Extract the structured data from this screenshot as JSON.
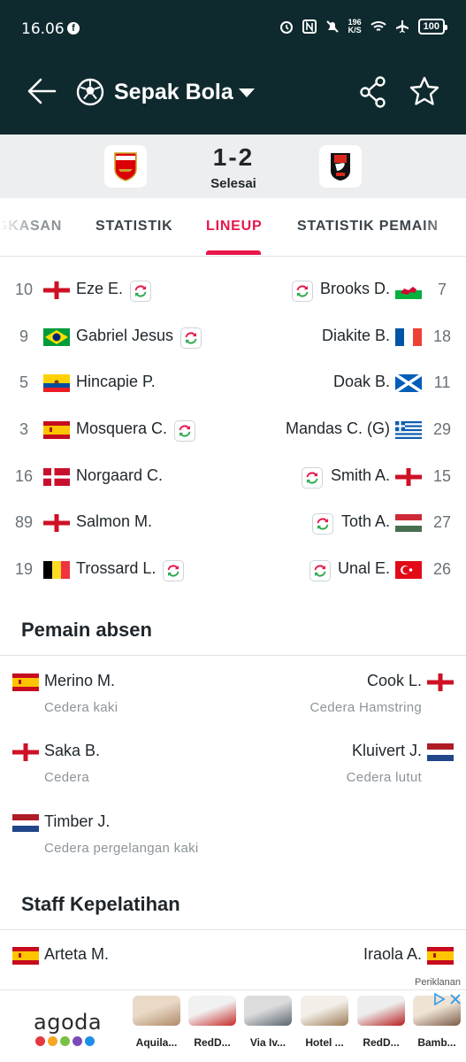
{
  "status_bar": {
    "time": "16.06",
    "net_speed_value": "196",
    "net_speed_unit": "K/S",
    "battery": "100"
  },
  "header": {
    "title": "Sepak Bola"
  },
  "match": {
    "score": "1-2",
    "status": "Selesai"
  },
  "tabs": [
    {
      "label": "GKASAN"
    },
    {
      "label": "STATISTIK"
    },
    {
      "label": "LINEUP"
    },
    {
      "label": "STATISTIK PEMAIN"
    }
  ],
  "lineup": {
    "home": [
      {
        "number": "10",
        "name": "Eze E.",
        "flag": "england",
        "sub": true
      },
      {
        "number": "9",
        "name": "Gabriel Jesus",
        "flag": "brazil",
        "sub": true
      },
      {
        "number": "5",
        "name": "Hincapie P.",
        "flag": "ecuador",
        "sub": false
      },
      {
        "number": "3",
        "name": "Mosquera C.",
        "flag": "spain",
        "sub": true
      },
      {
        "number": "16",
        "name": "Norgaard C.",
        "flag": "denmark",
        "sub": false
      },
      {
        "number": "89",
        "name": "Salmon M.",
        "flag": "england",
        "sub": false
      },
      {
        "number": "19",
        "name": "Trossard L.",
        "flag": "belgium",
        "sub": true
      }
    ],
    "away": [
      {
        "number": "7",
        "name": "Brooks D.",
        "flag": "wales",
        "sub": true
      },
      {
        "number": "18",
        "name": "Diakite B.",
        "flag": "france",
        "sub": false
      },
      {
        "number": "11",
        "name": "Doak B.",
        "flag": "scotland",
        "sub": false
      },
      {
        "number": "29",
        "name": "Mandas C. (G)",
        "flag": "greece",
        "sub": false
      },
      {
        "number": "15",
        "name": "Smith A.",
        "flag": "england",
        "sub": true
      },
      {
        "number": "27",
        "name": "Toth A.",
        "flag": "hungary",
        "sub": true
      },
      {
        "number": "26",
        "name": "Unal E.",
        "flag": "turkey",
        "sub": true
      }
    ]
  },
  "absent": {
    "title": "Pemain absen",
    "home": [
      {
        "name": "Merino M.",
        "reason": "Cedera kaki",
        "flag": "spain"
      },
      {
        "name": "Saka B.",
        "reason": "Cedera",
        "flag": "england"
      },
      {
        "name": "Timber J.",
        "reason": "Cedera pergelangan kaki",
        "flag": "netherlands"
      }
    ],
    "away": [
      {
        "name": "Cook L.",
        "reason": "Cedera Hamstring",
        "flag": "england"
      },
      {
        "name": "Kluivert J.",
        "reason": "Cedera lutut",
        "flag": "netherlands"
      }
    ]
  },
  "staff": {
    "title": "Staff Kepelatihan",
    "home": {
      "name": "Arteta M.",
      "flag": "spain"
    },
    "away": {
      "name": "Iraola A.",
      "flag": "spain"
    }
  },
  "ad": {
    "label": "Periklanan",
    "brand": "agoda",
    "hotels": [
      "Aquila...",
      "RedD...",
      "Via Iv...",
      "Hotel ...",
      "RedD...",
      "Bamb..."
    ]
  },
  "colors": {
    "header_bg": "#0f2a2f",
    "accent": "#e8174b"
  }
}
